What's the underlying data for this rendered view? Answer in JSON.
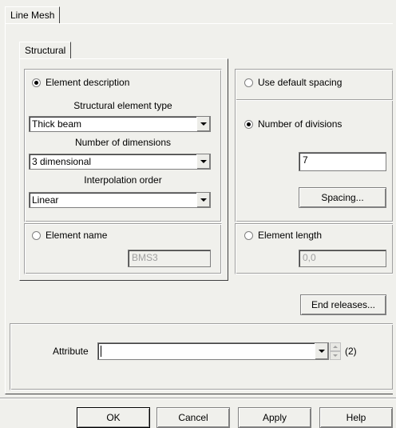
{
  "tabs": {
    "outer": "Line Mesh",
    "inner": "Structural"
  },
  "left": {
    "element_description": {
      "label": "Element description",
      "selected": true
    },
    "structural_element_type": {
      "label": "Structural element type",
      "value": "Thick beam"
    },
    "number_of_dimensions": {
      "label": "Number of dimensions",
      "value": "3 dimensional"
    },
    "interpolation_order": {
      "label": "Interpolation order",
      "value": "Linear"
    },
    "element_name": {
      "label": "Element name",
      "selected": false,
      "value": "BMS3"
    }
  },
  "right": {
    "use_default_spacing": {
      "label": "Use default spacing",
      "selected": false
    },
    "number_of_divisions": {
      "label": "Number of divisions",
      "selected": true,
      "value": "7"
    },
    "spacing_button": "Spacing...",
    "element_length": {
      "label": "Element length",
      "selected": false,
      "value": "0,0"
    }
  },
  "end_releases_button": "End releases...",
  "attribute": {
    "label": "Attribute",
    "value": "",
    "count": "(2)"
  },
  "footer": {
    "ok": "OK",
    "cancel": "Cancel",
    "apply": "Apply",
    "help": "Help"
  }
}
